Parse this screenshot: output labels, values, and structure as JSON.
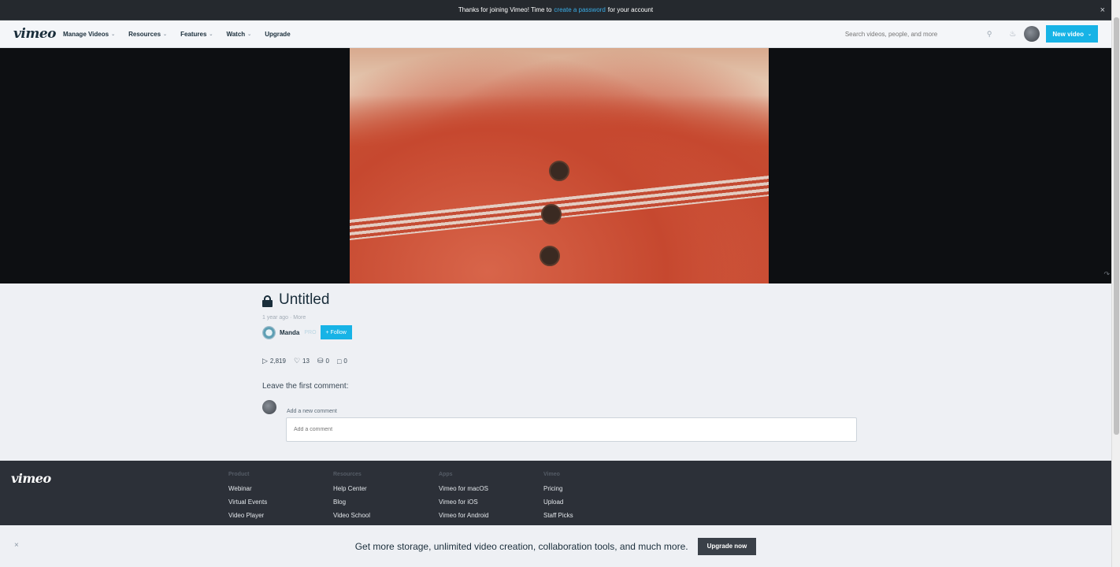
{
  "notice": {
    "text_before": "Thanks for joining Vimeo! Time to",
    "link": "create a password",
    "text_after": "for your account",
    "close": "×"
  },
  "nav": {
    "logo": "vimeo",
    "menu": [
      {
        "label": "Manage Videos",
        "has_dropdown": true
      },
      {
        "label": "Resources",
        "has_dropdown": true
      },
      {
        "label": "Features",
        "has_dropdown": true
      },
      {
        "label": "Watch",
        "has_dropdown": true
      },
      {
        "label": "Upgrade",
        "has_dropdown": false
      }
    ],
    "search_placeholder": "Search videos, people, and more",
    "new_video_label": "New video",
    "dropdown_glyph": "⌄"
  },
  "video": {
    "title": "Untitled",
    "meta": "1 year ago · More",
    "owner_name": "Manda",
    "owner_tag": "PRO",
    "follow_label": "+ Follow",
    "stats": {
      "plays": "2,819",
      "likes": "13",
      "collections": "0",
      "comments": "0"
    }
  },
  "comments": {
    "heading": "Leave the first comment:",
    "label": "Add a new comment",
    "placeholder": "Add a comment"
  },
  "footer": {
    "logo": "vimeo",
    "columns": [
      {
        "heading": "Product",
        "links": [
          "Webinar",
          "Virtual Events",
          "Video Player"
        ]
      },
      {
        "heading": "Resources",
        "links": [
          "Help Center",
          "Blog",
          "Video School"
        ]
      },
      {
        "heading": "Apps",
        "links": [
          "Vimeo for macOS",
          "Vimeo for iOS",
          "Vimeo for Android"
        ]
      },
      {
        "heading": "Vimeo",
        "links": [
          "Pricing",
          "Upload",
          "Staff Picks"
        ]
      }
    ]
  },
  "upgrade_bar": {
    "message": "Get more storage, unlimited video creation, collaboration tools, and much more.",
    "button": "Upgrade now",
    "close": "×"
  },
  "colors": {
    "accent": "#17b3e6",
    "dark": "#1a2e3b",
    "footer_bg": "#2c3038",
    "notice_bg": "#25292e"
  }
}
